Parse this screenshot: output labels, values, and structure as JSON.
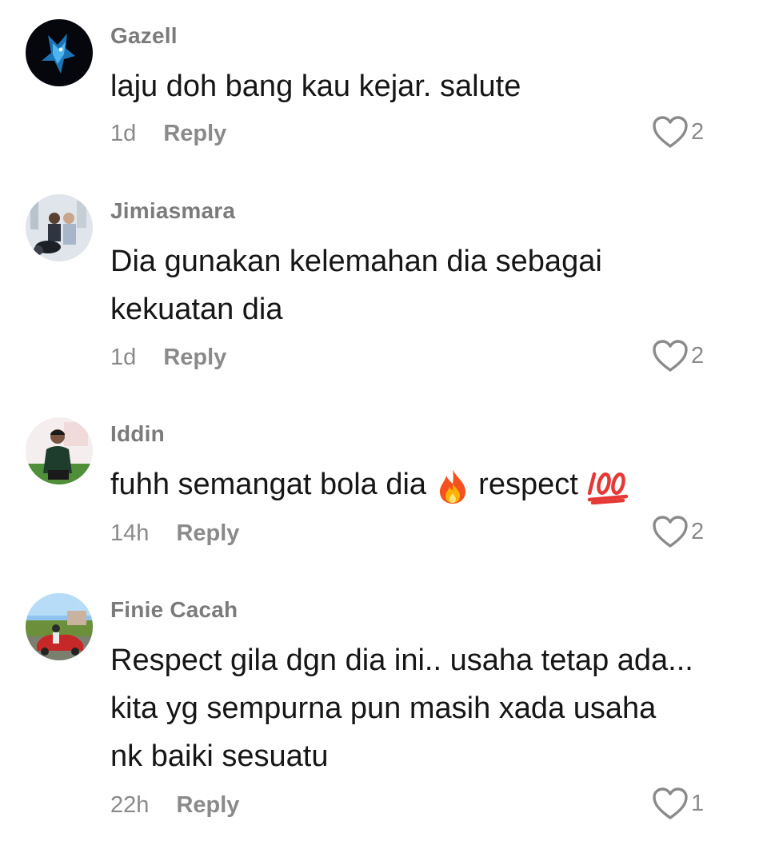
{
  "comments": [
    {
      "username": "Gazell",
      "text": "laju doh bang kau kejar. salute",
      "time": "1d",
      "reply_label": "Reply",
      "likes": "2",
      "avatar_icon": "blue-wolf-avatar"
    },
    {
      "username": "Jimiasmara",
      "text": "Dia gunakan kelemahan dia sebagai\nkekuatan dia",
      "time": "1d",
      "reply_label": "Reply",
      "likes": "2",
      "avatar_icon": "couple-motorcycle-avatar"
    },
    {
      "username": "Iddin",
      "text_part1": "fuhh semangat bola dia ",
      "text_part2": " respect ",
      "emoji1": "fire-emoji",
      "emoji2": "hundred-points-emoji",
      "time": "14h",
      "reply_label": "Reply",
      "likes": "2",
      "avatar_icon": "man-green-shirt-avatar"
    },
    {
      "username": "Finie Cacah",
      "text": "Respect gila dgn dia ini.. usaha tetap ada...\nkita yg sempurna pun masih xada usaha\nnk baiki sesuatu",
      "time": "22h",
      "reply_label": "Reply",
      "likes": "1",
      "avatar_icon": "red-car-outdoor-avatar"
    }
  ],
  "colors": {
    "username": "#7b7b7b",
    "text": "#161616",
    "meta": "#8a8a8a"
  }
}
